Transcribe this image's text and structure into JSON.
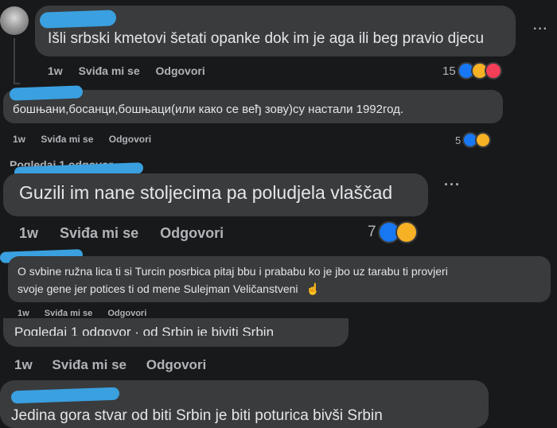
{
  "comments": [
    {
      "text": "Išli srbski kmetovi šetati opanke dok im je aga ili beg pravio djecu",
      "age": "1w",
      "like": "Sviđa mi se",
      "reply": "Odgovori",
      "count": "15"
    },
    {
      "text": "бошњани,босанци,бошњаци(или како се веђ зову)су настали 1992год.",
      "age": "1w",
      "like": "Sviđa mi se",
      "reply": "Odgovori",
      "count": "5"
    },
    {
      "text": "Guzili im nane stoljecima pa poludjela vlaščad",
      "age": "1w",
      "like": "Sviđa mi se",
      "reply": "Odgovori",
      "count": "7"
    },
    {
      "text_line1": "O svbine ružna lica ti si Turcin posrbica pitaj bbu i prababu ko je jbo uz tarabu ti provjeri",
      "text_line2": "svoje gene jer potices ti od mene Sulejman Veličanstveni",
      "age": "1w",
      "like": "Sviđa mi se",
      "reply": "Odgovori"
    },
    {
      "age": "1w",
      "like": "Sviđa mi se",
      "reply": "Odgovori"
    },
    {
      "text": "Jedina gora stvar od biti Srbin je biti poturica bivši Srbin"
    }
  ],
  "partial_text": {
    "view_more_1": "Pogledaj 1 odgovor",
    "overlap_line": "Pogledaj 1 odgovor · od Srbin je biviti Srbin"
  },
  "more_label": "···",
  "pointing_emoji": "☝",
  "icons": [
    "like-icon",
    "haha-icon",
    "love-icon",
    "more-options-icon",
    "avatar-icon"
  ],
  "colors": {
    "background": "#18191a",
    "bubble": "#3a3b3c",
    "text": "#e4e6eb",
    "secondary": "#b0b3b8",
    "like": "#1877f2",
    "haha": "#f7b125",
    "love": "#f33e58",
    "redaction": "#3aa0e0"
  }
}
